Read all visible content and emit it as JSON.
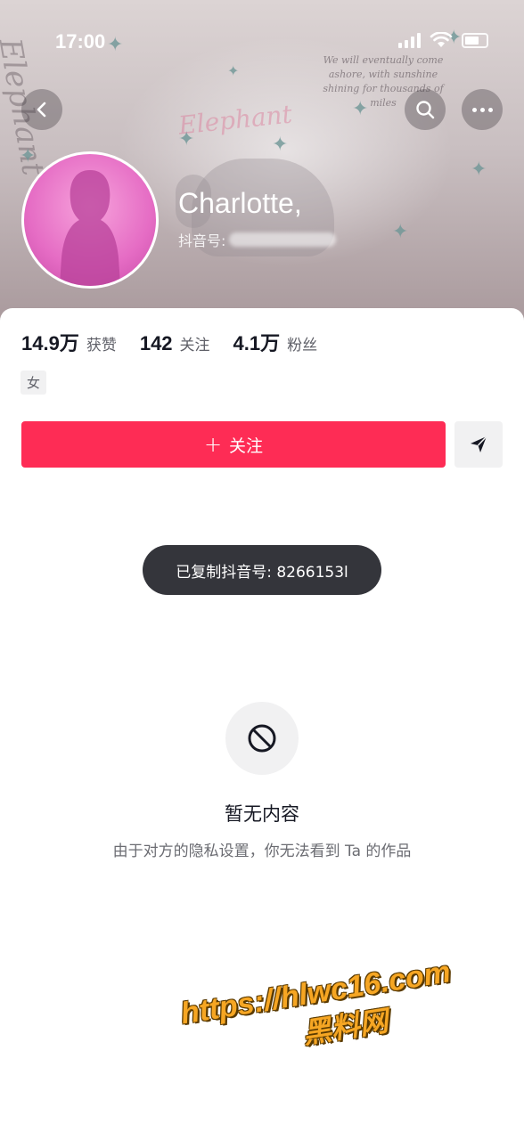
{
  "status_bar": {
    "time": "17:00"
  },
  "profile": {
    "username": "Charlotte,",
    "douyin_id_label": "抖音号:",
    "gender": "女",
    "header_deco": {
      "script_word": "Elephant",
      "poem": "We will eventually come ashore, with sunshine shining for thousands of miles"
    }
  },
  "stats": [
    {
      "value": "14.9万",
      "label": "获赞"
    },
    {
      "value": "142",
      "label": "关注"
    },
    {
      "value": "4.1万",
      "label": "粉丝"
    }
  ],
  "actions": {
    "follow_plus": "+",
    "follow_label": "关注"
  },
  "toast": {
    "text": "已复制抖音号: 8266153l"
  },
  "empty_state": {
    "title": "暂无内容",
    "description": "由于对方的隐私设置，你无法看到 Ta 的作品"
  },
  "watermark": {
    "url": "https://hlwc16.com",
    "name": "黑料网"
  },
  "colors": {
    "accent": "#fe2c55",
    "toast_bg": "#34353b",
    "watermark": "#f6a623"
  }
}
